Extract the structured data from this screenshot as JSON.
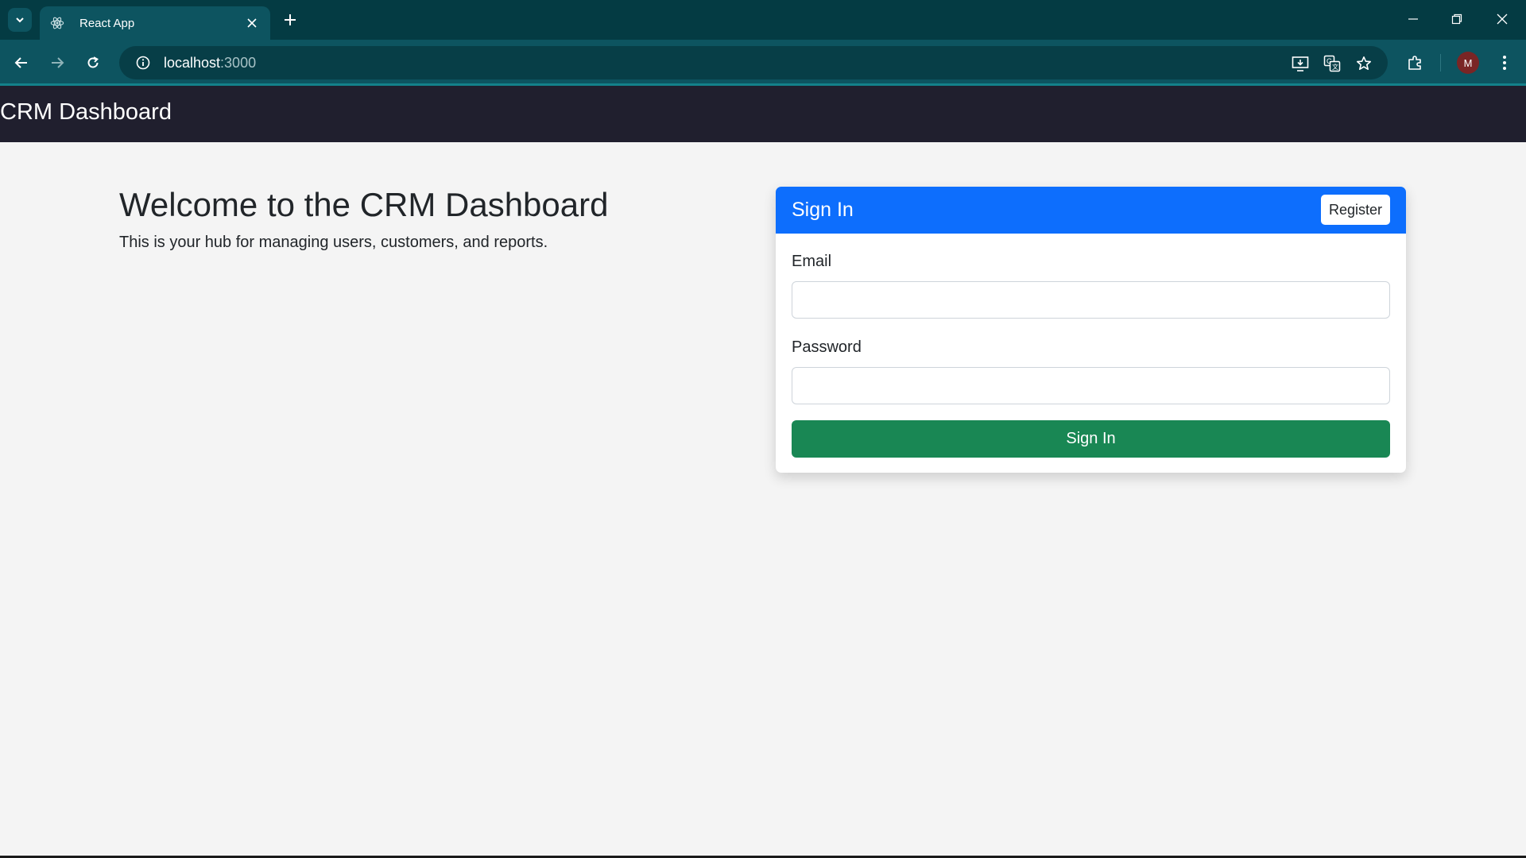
{
  "browser": {
    "tab_title": "React App",
    "url_host": "localhost",
    "url_port": ":3000",
    "avatar_initial": "M",
    "colors": {
      "tabbar": "#043b43",
      "toolbar": "#0d5460",
      "omnibox": "#073e47"
    }
  },
  "app": {
    "header_title": "CRM Dashboard",
    "welcome": {
      "heading": "Welcome to the CRM Dashboard",
      "subtext": "This is your hub for managing users, customers, and reports."
    },
    "signin_card": {
      "title": "Sign In",
      "register_label": "Register",
      "email_label": "Email",
      "email_value": "",
      "password_label": "Password",
      "password_value": "",
      "submit_label": "Sign In"
    },
    "colors": {
      "header": "#201f2e",
      "primary": "#0d6efd",
      "success": "#198754",
      "background": "#f4f4f4"
    }
  },
  "icons": [
    "tab-search-icon",
    "react-icon",
    "close-icon",
    "plus-icon",
    "minimize-icon",
    "restore-icon",
    "window-close-icon",
    "back-arrow-icon",
    "forward-arrow-icon",
    "reload-icon",
    "info-icon",
    "install-app-icon",
    "translate-icon",
    "star-icon",
    "extensions-icon",
    "kebab-menu-icon"
  ]
}
